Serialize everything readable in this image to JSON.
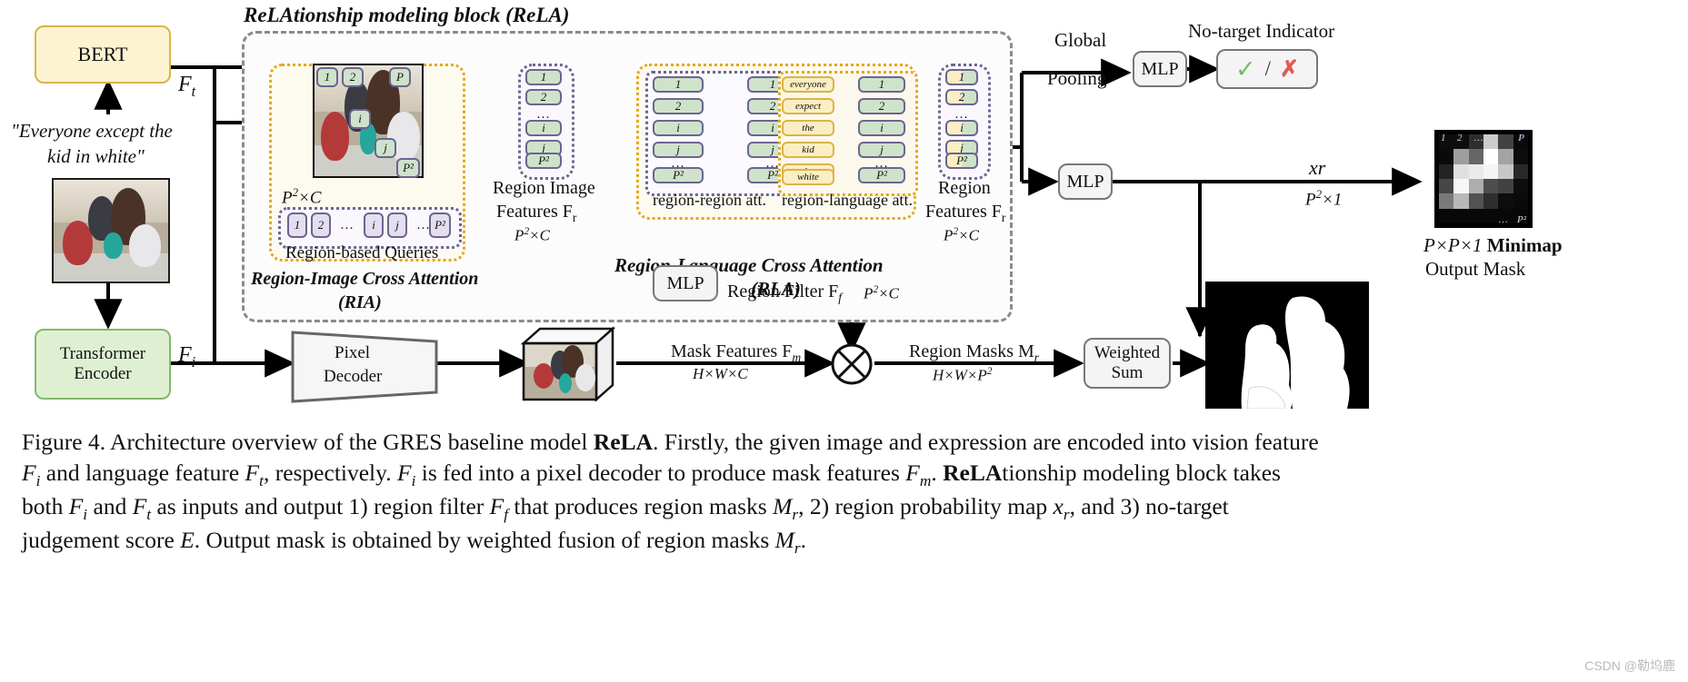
{
  "figure": {
    "title_block": "ReLAtionship modeling block (ReLA)",
    "rla_title": "Region-Language Cross Attention",
    "rla_sub": "(RLA)",
    "ria_title": "Region-Image Cross Attention",
    "ria_sub": "(RIA)"
  },
  "nodes": {
    "bert": "BERT",
    "encoder_line1": "Transformer",
    "encoder_line2": "Encoder",
    "pixel_line1": "Pixel",
    "pixel_line2": "Decoder",
    "mlp": "MLP",
    "weighted_line1": "Weighted",
    "weighted_line2": "Sum"
  },
  "labels": {
    "expression": "\"Everyone except the",
    "expression2": "kid in white\"",
    "Ft": "F",
    "Ft_sub": "t",
    "Fi": "F",
    "Fi_sub": "i",
    "p2c": "P²×C",
    "region_queries": "Region-based Queries",
    "region_image_features_1": "Region Image",
    "region_image_features_2": "Features F",
    "region_image_features_sub": "r",
    "region_image_dim": "P²×C",
    "region_region_att": "region-region att.",
    "region_language_att": "region-language att.",
    "region_features_1": "Region",
    "region_features_2": "Features F",
    "region_features_sub": "r",
    "region_features_dim": "P²×C",
    "global_pooling_1": "Global",
    "global_pooling_2": "Pooling",
    "no_target_indicator": "No-target Indicator",
    "xr": "xr",
    "p2x1": "P²×1",
    "minimap_caption_1": "P×P×1",
    "minimap_caption_2": "Minimap",
    "output_mask": "Output Mask",
    "region_filter": "Region Filter F",
    "region_filter_sub": "f",
    "region_filter_dim": "P²×C",
    "mask_features": "Mask Features F",
    "mask_features_sub": "m",
    "mask_features_dim": "H×W×C",
    "region_masks": "Region Masks M",
    "region_masks_sub": "r",
    "region_masks_dim": "H×W×P²"
  },
  "tokens": {
    "region_queries": [
      "1",
      "2",
      "…",
      "i",
      "j",
      "…",
      "P²"
    ],
    "region_image_features": [
      "1",
      "2",
      "…",
      "i",
      "j",
      "…",
      "P²"
    ],
    "region_region_left": [
      "1",
      "2",
      "…",
      "i",
      "j",
      "…",
      "P²"
    ],
    "region_region_right": [
      "1",
      "2",
      "…",
      "i",
      "j",
      "…",
      "P²"
    ],
    "language_tokens": [
      "everyone",
      "expect",
      "the",
      "kid",
      "in",
      "white"
    ],
    "region_language_right": [
      "1",
      "2",
      "…",
      "i",
      "j",
      "…",
      "P²"
    ],
    "region_features": [
      "1",
      "2",
      "…",
      "i",
      "j",
      "…",
      "P²"
    ],
    "image_patch_labels": [
      "1",
      "2",
      "P",
      "i",
      "j",
      "P²"
    ]
  },
  "indicator": {
    "check": "✓",
    "slash": "/",
    "cross": "✗"
  },
  "minimap": {
    "corner_labels": [
      "1",
      "2",
      "…",
      "P",
      "…",
      "P²"
    ],
    "grid": [
      [
        0.05,
        0.05,
        0.18,
        0.8,
        0.26,
        0.04
      ],
      [
        0.04,
        0.62,
        0.4,
        1.0,
        0.64,
        0.05
      ],
      [
        0.14,
        0.88,
        0.92,
        0.96,
        0.78,
        0.16
      ],
      [
        0.28,
        0.97,
        0.68,
        0.3,
        0.26,
        0.05
      ],
      [
        0.48,
        0.72,
        0.32,
        0.18,
        0.05,
        0.04
      ],
      [
        0.03,
        0.03,
        0.03,
        0.03,
        0.03,
        0.03
      ]
    ]
  },
  "caption": {
    "text_1": "Figure 4. Architecture overview of the GRES baseline model ",
    "bold_1": "ReLA",
    "text_2": ". Firstly, the given image and expression are encoded into vision feature",
    "text_3": " and language feature ",
    "text_4": ", respectively. ",
    "text_5": " is fed into a pixel decoder to produce mask features ",
    "bold_2": "ReLA",
    "text_6": "tionship modeling block takes",
    "text_7": "both ",
    "text_8": " and ",
    "text_9": " as inputs and output 1) region filter ",
    "text_10": " that produces region masks ",
    "text_11": ", 2) region probability map ",
    "text_12": ", and 3) no-target",
    "text_13": "judgement score ",
    "text_14": ". Output mask is obtained by weighted fusion of region masks ",
    "text_15": "."
  },
  "watermark": "CSDN @勒坞鹿",
  "colors": {
    "bert_fill": "#fdf3d2",
    "bert_border": "#d9b44a",
    "encoder_fill": "#dff0d2",
    "encoder_border": "#84b96a",
    "green_token": "#cfe3cb",
    "purple_token": "#e4def0",
    "yellow_token": "#fbeec2",
    "orange_dotted": "#e3a81e",
    "purple_dotted": "#6b6590",
    "gray_dashed": "#8b8b8b",
    "check_green": "#6fbf5e",
    "cross_red": "#e05a55",
    "arrow_green": "#6aa84f"
  }
}
